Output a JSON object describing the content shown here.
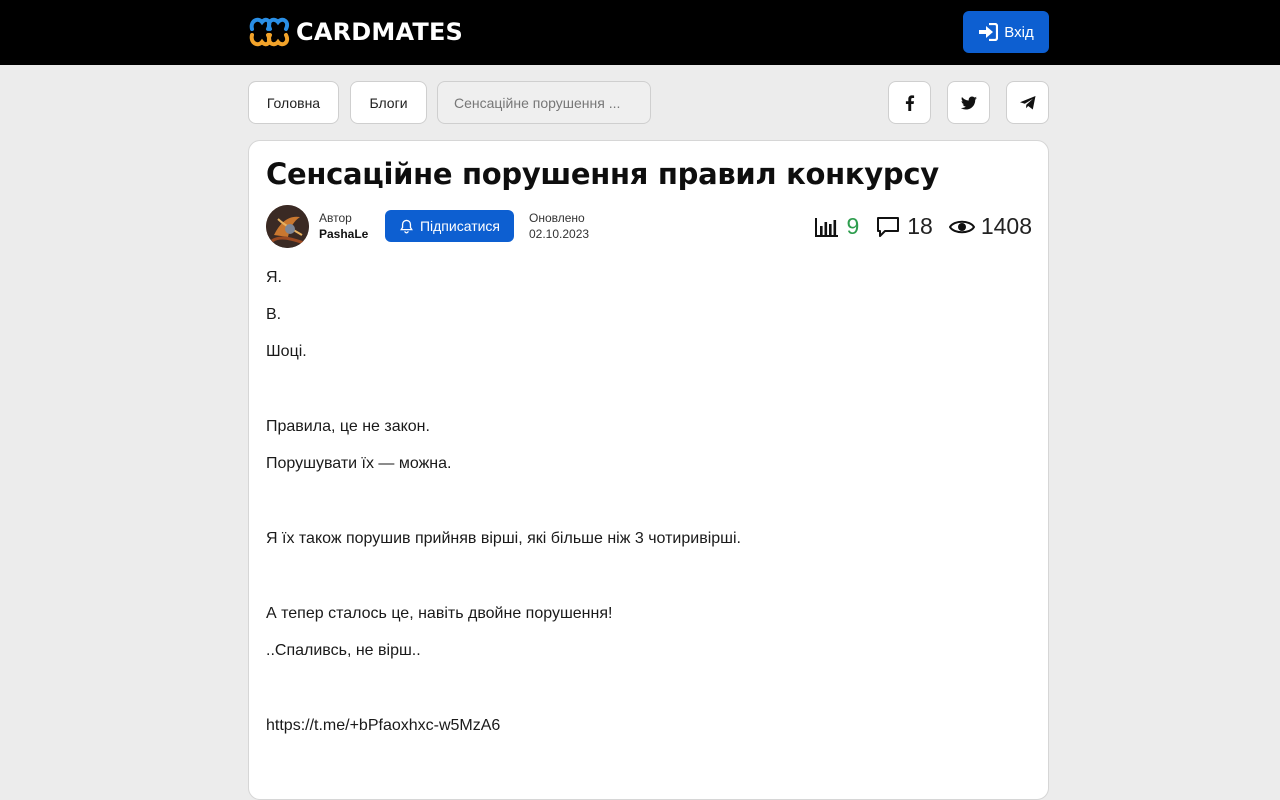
{
  "header": {
    "brand": "CARDMATES",
    "login_label": "Вхід",
    "logo_colors": [
      "#2a8fe6",
      "#f2a32a"
    ]
  },
  "breadcrumb": {
    "home": "Головна",
    "blogs": "Блоги",
    "current": "Сенсаційне порушення ..."
  },
  "share": {
    "icons": [
      "facebook-icon",
      "twitter-icon",
      "telegram-icon"
    ]
  },
  "post": {
    "title": "Сенсаційне порушення правил конкурсу",
    "author_label": "Автор",
    "author_name": "PashaLe",
    "subscribe_label": "Підписатися",
    "updated_label": "Оновлено",
    "updated_date": "02.10.2023",
    "rating": "9",
    "comments": "18",
    "views": "1408",
    "paragraphs": [
      "Я.",
      "В.",
      "Шоці.",
      "Правила, це не закон.",
      "Порушувати їх — можна.",
      "Я їх також порушив прийняв вірші, які більше ніж 3 чотиривірші.",
      "А тепер сталось це, навіть двойне порушення!",
      "..Спаливсь, не вірш..",
      "https://t.me/+bPfaoxhxc-w5MzA6"
    ]
  },
  "colors": {
    "accent": "#0d5fd1",
    "rating": "#2e9d4e"
  }
}
